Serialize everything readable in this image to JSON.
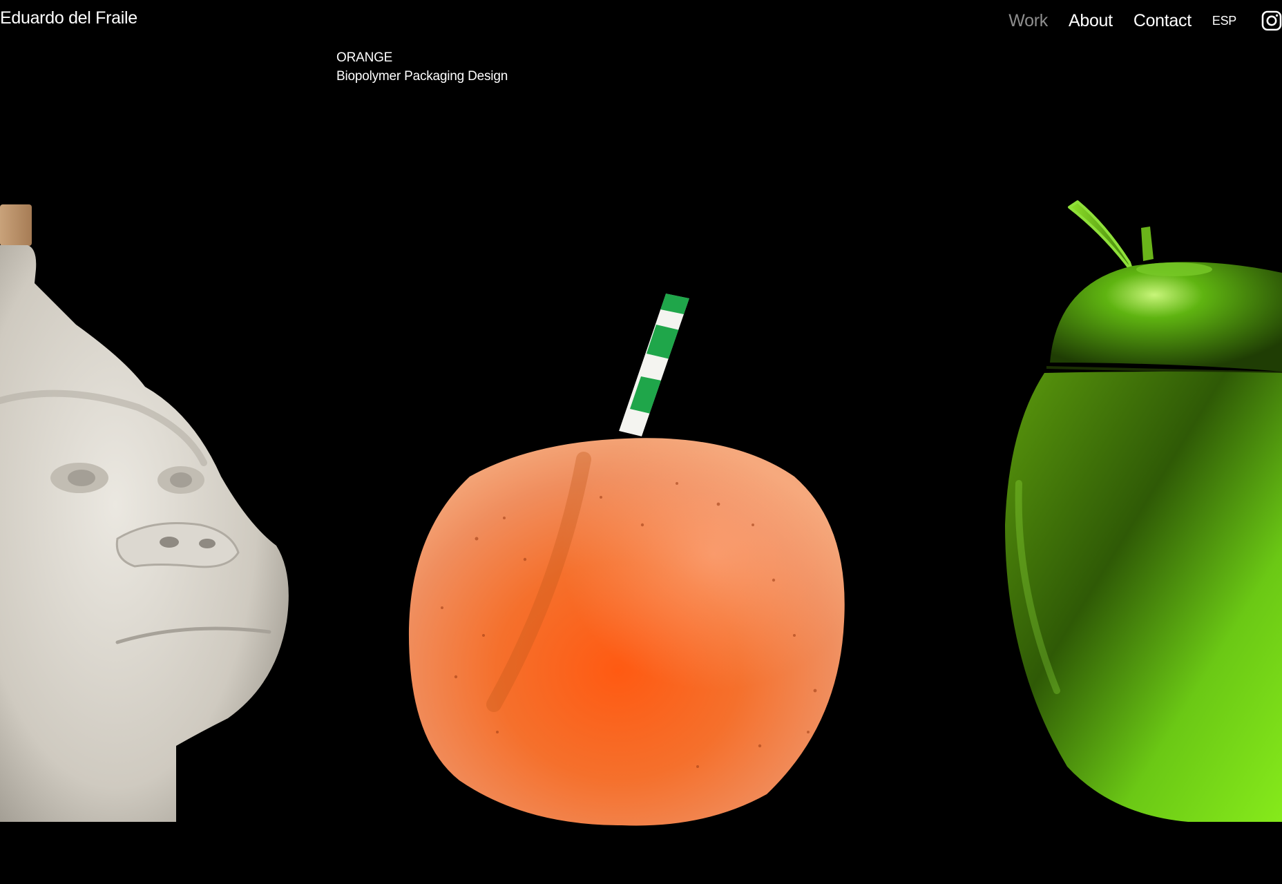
{
  "header": {
    "brand": "Eduardo del Fraile",
    "nav": [
      {
        "label": "Work",
        "active": true
      },
      {
        "label": "About",
        "active": false
      },
      {
        "label": "Contact",
        "active": false
      },
      {
        "label": "ESP",
        "active": false
      }
    ],
    "social_icon": "instagram-icon"
  },
  "project": {
    "name": "ORANGE",
    "subtitle": "Biopolymer Packaging Design"
  },
  "colors": {
    "background": "#000000",
    "text": "#ffffff",
    "nav_active": "#8e8e8e",
    "orange_product": "#f06a2c",
    "green_product": "#6fd11a",
    "gorilla_product": "#d8d4cc",
    "straw_green": "#1fa64a"
  }
}
